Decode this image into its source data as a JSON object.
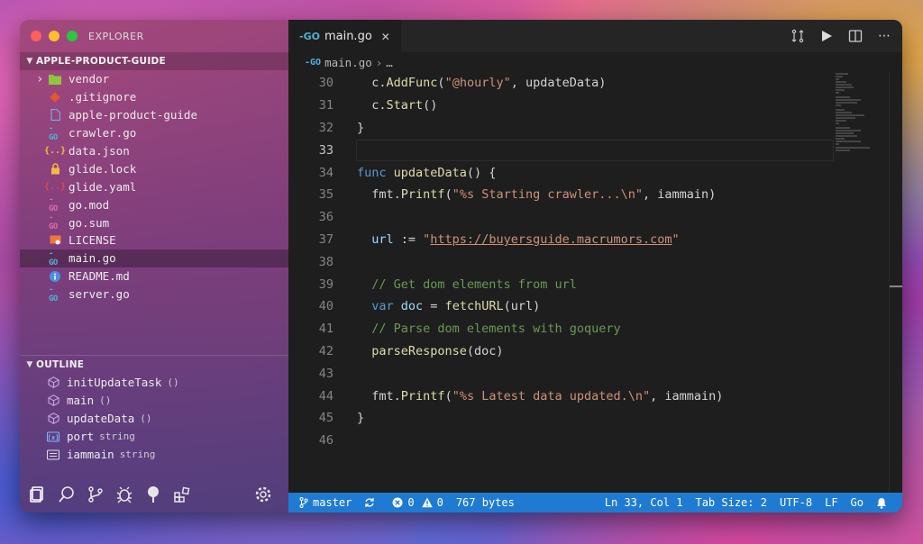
{
  "sidebar": {
    "title": "EXPLORER",
    "project": "APPLE-PRODUCT-GUIDE",
    "files": [
      {
        "name": "vendor",
        "icon": "folder-icon",
        "color": "#8dc63f",
        "folder": true
      },
      {
        "name": ".gitignore",
        "icon": "git-icon",
        "color": "#e8562f"
      },
      {
        "name": "apple-product-guide",
        "icon": "file-icon",
        "color": "#7aa7e8"
      },
      {
        "name": "crawler.go",
        "icon": "go-icon",
        "color": "#4fb3d9"
      },
      {
        "name": "data.json",
        "icon": "json-icon",
        "color": "#f1c232"
      },
      {
        "name": "glide.lock",
        "icon": "lock-icon",
        "color": "#f5b942"
      },
      {
        "name": "glide.yaml",
        "icon": "yaml-icon",
        "color": "#d24f4f"
      },
      {
        "name": "go.mod",
        "icon": "go-mod-icon",
        "color": "#e36aa8"
      },
      {
        "name": "go.sum",
        "icon": "go-sum-icon",
        "color": "#e36aa8"
      },
      {
        "name": "LICENSE",
        "icon": "license-icon",
        "color": "#f2763b"
      },
      {
        "name": "main.go",
        "icon": "go-icon",
        "color": "#4fb3d9",
        "selected": true
      },
      {
        "name": "README.md",
        "icon": "info-icon",
        "color": "#4a8fe6"
      },
      {
        "name": "server.go",
        "icon": "go-icon",
        "color": "#4fb3d9"
      }
    ],
    "outline_title": "OUTLINE",
    "outline": [
      {
        "name": "initUpdateTask",
        "type": "()",
        "icon": "method-icon"
      },
      {
        "name": "main",
        "type": "()",
        "icon": "method-icon"
      },
      {
        "name": "updateData",
        "type": "()",
        "icon": "method-icon"
      },
      {
        "name": "port",
        "type": "string",
        "icon": "variable-icon"
      },
      {
        "name": "iammain",
        "type": "string",
        "icon": "field-icon"
      }
    ]
  },
  "editor": {
    "tab": "main.go",
    "breadcrumb_file": "main.go",
    "breadcrumb_more": "…",
    "current_line": 33
  },
  "code_lines": [
    {
      "n": "30",
      "t": [
        [
          "op",
          "  c."
        ],
        [
          "fn",
          "AddFunc"
        ],
        [
          "op",
          "("
        ],
        [
          "str",
          "\"@hourly\""
        ],
        [
          "op",
          ", updateData)"
        ]
      ]
    },
    {
      "n": "31",
      "t": [
        [
          "op",
          "  c."
        ],
        [
          "fn",
          "Start"
        ],
        [
          "op",
          "()"
        ]
      ]
    },
    {
      "n": "32",
      "t": [
        [
          "op",
          "}"
        ]
      ]
    },
    {
      "n": "33",
      "t": []
    },
    {
      "n": "34",
      "t": [
        [
          "kw",
          "func "
        ],
        [
          "fn",
          "updateData"
        ],
        [
          "op",
          "() {"
        ]
      ]
    },
    {
      "n": "35",
      "t": [
        [
          "op",
          "  fmt."
        ],
        [
          "fn",
          "Printf"
        ],
        [
          "op",
          "("
        ],
        [
          "str",
          "\"%s Starting crawler...\\n\""
        ],
        [
          "op",
          ", iammain)"
        ]
      ]
    },
    {
      "n": "36",
      "t": []
    },
    {
      "n": "37",
      "t": [
        [
          "var",
          "  url"
        ],
        [
          "op",
          " := "
        ],
        [
          "str",
          "\""
        ],
        [
          "url",
          "https://buyersguide.macrumors.com"
        ],
        [
          "str",
          "\""
        ]
      ]
    },
    {
      "n": "38",
      "t": []
    },
    {
      "n": "39",
      "t": [
        [
          "cm",
          "  // Get dom elements from url"
        ]
      ]
    },
    {
      "n": "40",
      "t": [
        [
          "kw",
          "  var "
        ],
        [
          "var",
          "doc"
        ],
        [
          "op",
          " = "
        ],
        [
          "fn",
          "fetchURL"
        ],
        [
          "op",
          "(url)"
        ]
      ]
    },
    {
      "n": "41",
      "t": [
        [
          "cm",
          "  // Parse dom elements with goquery"
        ]
      ]
    },
    {
      "n": "42",
      "t": [
        [
          "fn",
          "  parseResponse"
        ],
        [
          "op",
          "(doc)"
        ]
      ]
    },
    {
      "n": "43",
      "t": []
    },
    {
      "n": "44",
      "t": [
        [
          "op",
          "  fmt."
        ],
        [
          "fn",
          "Printf"
        ],
        [
          "op",
          "("
        ],
        [
          "str",
          "\"%s Latest data updated.\\n\""
        ],
        [
          "op",
          ", iammain)"
        ]
      ]
    },
    {
      "n": "45",
      "t": [
        [
          "op",
          "}"
        ]
      ]
    },
    {
      "n": "46",
      "t": []
    }
  ],
  "status": {
    "branch": "master",
    "errors": "0",
    "warnings": "0",
    "size": "767 bytes",
    "position": "Ln 33, Col 1",
    "tab_size": "Tab Size: 2",
    "encoding": "UTF-8",
    "eol": "LF",
    "language": "Go"
  },
  "colors": {
    "status_bar": "#1f7bd2",
    "editor_bg": "#1e1e1e"
  }
}
